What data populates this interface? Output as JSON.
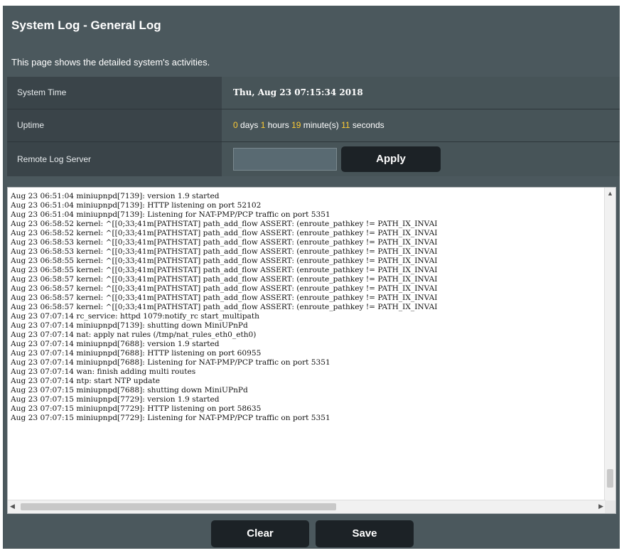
{
  "page": {
    "title": "System Log - General Log",
    "description": "This page shows the detailed system's activities."
  },
  "system_time": {
    "label": "System Time",
    "value": "Thu, Aug 23 07:15:34 2018"
  },
  "uptime": {
    "label": "Uptime",
    "days": "0",
    "days_unit": " days ",
    "hours": "1",
    "hours_unit": " hours ",
    "minutes": "19",
    "minutes_unit": " minute(s) ",
    "seconds": "11",
    "seconds_unit": " seconds"
  },
  "remote_log": {
    "label": "Remote Log Server",
    "input_value": "",
    "apply_label": "Apply"
  },
  "log": {
    "lines": [
      "Aug 23 06:51:04 miniupnpd[7139]: version 1.9 started",
      "Aug 23 06:51:04 miniupnpd[7139]: HTTP listening on port 52102",
      "Aug 23 06:51:04 miniupnpd[7139]: Listening for NAT-PMP/PCP traffic on port 5351",
      "Aug 23 06:58:52 kernel: ^[[0;33;41m[PATHSTAT] path_add_flow ASSERT: (enroute_pathkey != PATH_IX_INVAI",
      "Aug 23 06:58:52 kernel: ^[[0;33;41m[PATHSTAT] path_add_flow ASSERT: (enroute_pathkey != PATH_IX_INVAI",
      "Aug 23 06:58:53 kernel: ^[[0;33;41m[PATHSTAT] path_add_flow ASSERT: (enroute_pathkey != PATH_IX_INVAI",
      "Aug 23 06:58:53 kernel: ^[[0;33;41m[PATHSTAT] path_add_flow ASSERT: (enroute_pathkey != PATH_IX_INVAI",
      "Aug 23 06:58:55 kernel: ^[[0;33;41m[PATHSTAT] path_add_flow ASSERT: (enroute_pathkey != PATH_IX_INVAI",
      "Aug 23 06:58:55 kernel: ^[[0;33;41m[PATHSTAT] path_add_flow ASSERT: (enroute_pathkey != PATH_IX_INVAI",
      "Aug 23 06:58:57 kernel: ^[[0;33;41m[PATHSTAT] path_add_flow ASSERT: (enroute_pathkey != PATH_IX_INVAI",
      "Aug 23 06:58:57 kernel: ^[[0;33;41m[PATHSTAT] path_add_flow ASSERT: (enroute_pathkey != PATH_IX_INVAI",
      "Aug 23 06:58:57 kernel: ^[[0;33;41m[PATHSTAT] path_add_flow ASSERT: (enroute_pathkey != PATH_IX_INVAI",
      "Aug 23 06:58:57 kernel: ^[[0;33;41m[PATHSTAT] path_add_flow ASSERT: (enroute_pathkey != PATH_IX_INVAI",
      "Aug 23 07:07:14 rc_service: httpd 1079:notify_rc start_multipath",
      "Aug 23 07:07:14 miniupnpd[7139]: shutting down MiniUPnPd",
      "Aug 23 07:07:14 nat: apply nat rules (/tmp/nat_rules_eth0_eth0)",
      "Aug 23 07:07:14 miniupnpd[7688]: version 1.9 started",
      "Aug 23 07:07:14 miniupnpd[7688]: HTTP listening on port 60955",
      "Aug 23 07:07:14 miniupnpd[7688]: Listening for NAT-PMP/PCP traffic on port 5351",
      "Aug 23 07:07:14 wan: finish adding multi routes",
      "Aug 23 07:07:14 ntp: start NTP update",
      "Aug 23 07:07:15 miniupnpd[7688]: shutting down MiniUPnPd",
      "Aug 23 07:07:15 miniupnpd[7729]: version 1.9 started",
      "Aug 23 07:07:15 miniupnpd[7729]: HTTP listening on port 58635",
      "Aug 23 07:07:15 miniupnpd[7729]: Listening for NAT-PMP/PCP traffic on port 5351"
    ]
  },
  "buttons": {
    "clear": "Clear",
    "save": "Save"
  },
  "icons": {
    "scroll_up": "triangle-up",
    "scroll_left": "triangle-left",
    "scroll_right": "triangle-right"
  },
  "colors": {
    "panel_bg": "#4b585d",
    "highlight_number": "#ffcc33",
    "button_bg": "#1c2226"
  }
}
